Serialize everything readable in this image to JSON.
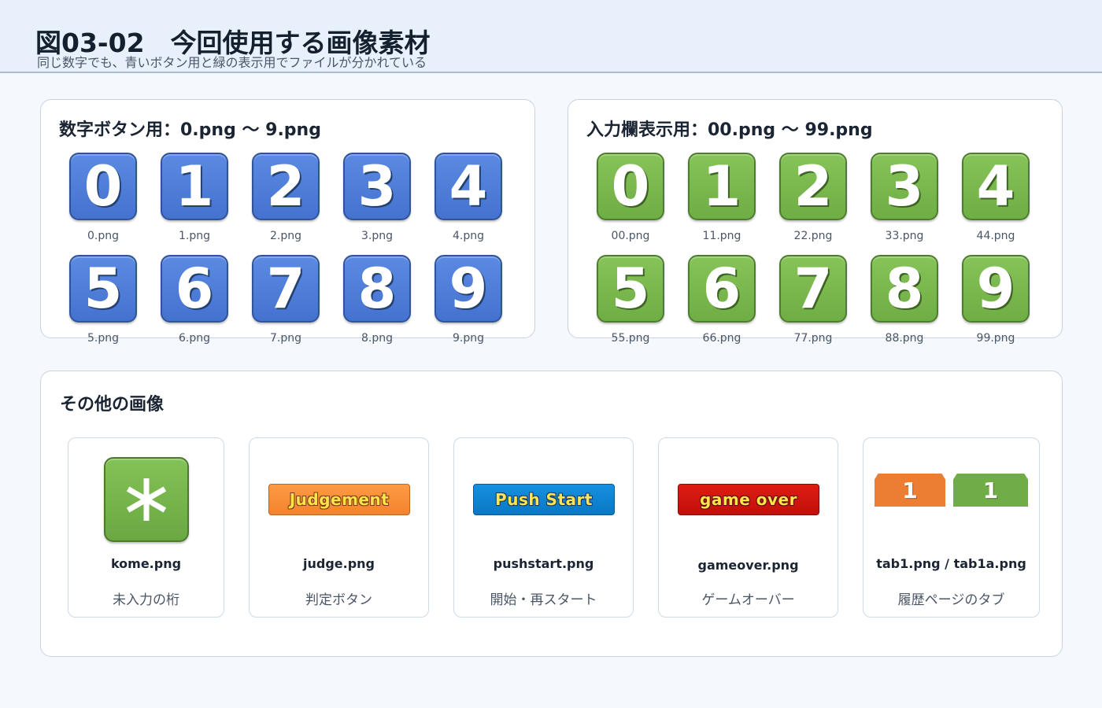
{
  "header": {
    "title": "図03-02　今回使用する画像素材",
    "subtitle": "同じ数字でも、青いボタン用と緑の表示用でファイルが分かれている"
  },
  "panel_blue": {
    "title": "数字ボタン用：0.png ～ 9.png",
    "color": "#4a78d6",
    "items": [
      {
        "digit": "0",
        "file": "0.png"
      },
      {
        "digit": "1",
        "file": "1.png"
      },
      {
        "digit": "2",
        "file": "2.png"
      },
      {
        "digit": "3",
        "file": "3.png"
      },
      {
        "digit": "4",
        "file": "4.png"
      },
      {
        "digit": "5",
        "file": "5.png"
      },
      {
        "digit": "6",
        "file": "6.png"
      },
      {
        "digit": "7",
        "file": "7.png"
      },
      {
        "digit": "8",
        "file": "8.png"
      },
      {
        "digit": "9",
        "file": "9.png"
      }
    ]
  },
  "panel_green": {
    "title": "入力欄表示用：00.png ～ 99.png",
    "color": "#77b74c",
    "items": [
      {
        "digit": "0",
        "file": "00.png"
      },
      {
        "digit": "1",
        "file": "11.png"
      },
      {
        "digit": "2",
        "file": "22.png"
      },
      {
        "digit": "3",
        "file": "33.png"
      },
      {
        "digit": "4",
        "file": "44.png"
      },
      {
        "digit": "5",
        "file": "55.png"
      },
      {
        "digit": "6",
        "file": "66.png"
      },
      {
        "digit": "7",
        "file": "77.png"
      },
      {
        "digit": "8",
        "file": "88.png"
      },
      {
        "digit": "9",
        "file": "99.png"
      }
    ]
  },
  "panel_other": {
    "title": "その他の画像",
    "cards": [
      {
        "file": "kome.png",
        "desc": "未入力の桁",
        "icon": "asterisk-icon"
      },
      {
        "file": "judge.png",
        "desc": "判定ボタン",
        "button_text": "Judgement",
        "color": "#f2832f"
      },
      {
        "file": "pushstart.png",
        "desc": "開始・再スタート",
        "button_text": "Push Start",
        "color": "#0a77c4"
      },
      {
        "file": "gameover.png",
        "desc": "ゲームオーバー",
        "button_text": "game over",
        "color": "#c20f0a"
      },
      {
        "file": "tab1.png / tab1a.png",
        "desc": "履歴ページのタブ",
        "tab1_text": "1",
        "tab1a_text": "1",
        "tab1_color": "#ec7e34",
        "tab1a_color": "#70ad47"
      }
    ]
  }
}
